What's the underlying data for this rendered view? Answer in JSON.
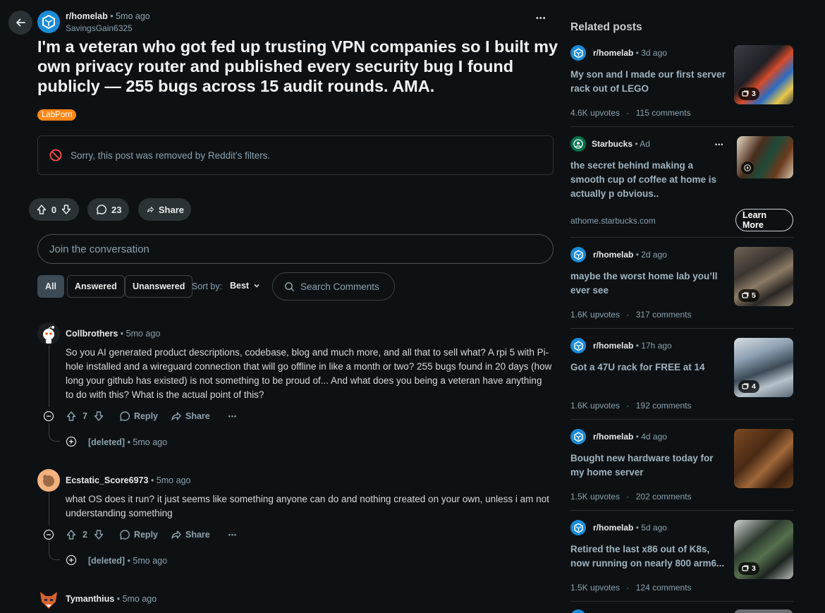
{
  "post": {
    "subreddit": "r/homelab",
    "time": "• 5mo ago",
    "author": "SavingsGain6325",
    "more": "•••",
    "title": "I'm a veteran who got fed up trusting VPN companies so I built my own privacy router and published every security bug I found publicly — 255 bugs across 15 audit rounds. AMA.",
    "flair": "LabPorn",
    "removed_notice": "Sorry, this post was removed by Reddit’s filters.",
    "votes": "0",
    "comments_count": "23",
    "share_label": "Share"
  },
  "comment_box": {
    "placeholder": "Join the conversation"
  },
  "filters": {
    "all": "All",
    "answered": "Answered",
    "unanswered": "Unanswered",
    "sort_label": "Sort by:",
    "sort_value": "Best",
    "search_placeholder": "Search Comments"
  },
  "comments": [
    {
      "author": "Collbrothers",
      "time": "• 5mo ago",
      "body": "So you AI generated product descriptions, codebase, blog and much more, and all that to sell what? A rpi 5 with Pi-hole installed and a wireguard connection that will go offline in like a month or two? 255 bugs found in 20 days (how long your github has existed) is not something to be proud of... And what does you being a veteran have anything to do with this? What is the actual point of this?",
      "votes": "7",
      "reply": "Reply",
      "share": "Share",
      "more": "•••",
      "deleted": "[deleted]",
      "deleted_time": "• 5mo ago"
    },
    {
      "author": "Ecstatic_Score6973",
      "time": "• 5mo ago",
      "body": "what OS does it run? it just seems like something anyone can do and nothing created on your own, unless i am not understanding something",
      "votes": "2",
      "reply": "Reply",
      "share": "Share",
      "more": "•••",
      "deleted": "[deleted]",
      "deleted_time": "• 5mo ago"
    },
    {
      "author": "Tymanthius",
      "time": "• 5mo ago"
    }
  ],
  "sidebar": {
    "title": "Related posts",
    "posts": [
      {
        "sub": "r/homelab",
        "time": "• 3d ago",
        "title": "My son and I made our first server rack out of LEGO",
        "upvotes": "4.6K upvotes",
        "comments": "115 comments",
        "images": "3"
      },
      {
        "sub": "r/homelab",
        "time": "• 2d ago",
        "title": "maybe the worst home lab you’ll ever see",
        "upvotes": "1.6K upvotes",
        "comments": "317 comments",
        "images": "5"
      },
      {
        "sub": "r/homelab",
        "time": "• 17h ago",
        "title": "Got a 47U rack for FREE at 14",
        "upvotes": "1.6K upvotes",
        "comments": "192 comments",
        "images": "4"
      },
      {
        "sub": "r/homelab",
        "time": "• 4d ago",
        "title": "Bought new hardware today for my home server",
        "upvotes": "1.5K upvotes",
        "comments": "202 comments"
      },
      {
        "sub": "r/homelab",
        "time": "• 5d ago",
        "title": "Retired the last x86 out of K8s, now running on nearly 800 arm6...",
        "upvotes": "1.5K upvotes",
        "comments": "124 comments",
        "images": "3"
      }
    ],
    "ad": {
      "brand": "Starbucks",
      "tag": "• Ad",
      "more": "•••",
      "title": "the secret behind making a smooth cup of coffee at home is actually p obvious..",
      "domain": "athome.starbucks.com",
      "cta": "Learn More"
    },
    "stat_sep": "·"
  },
  "colors": {
    "background": "#0e1113",
    "accent": "#1a8bd8",
    "flair": "#ff8717",
    "muted": "#8ba2ad"
  }
}
